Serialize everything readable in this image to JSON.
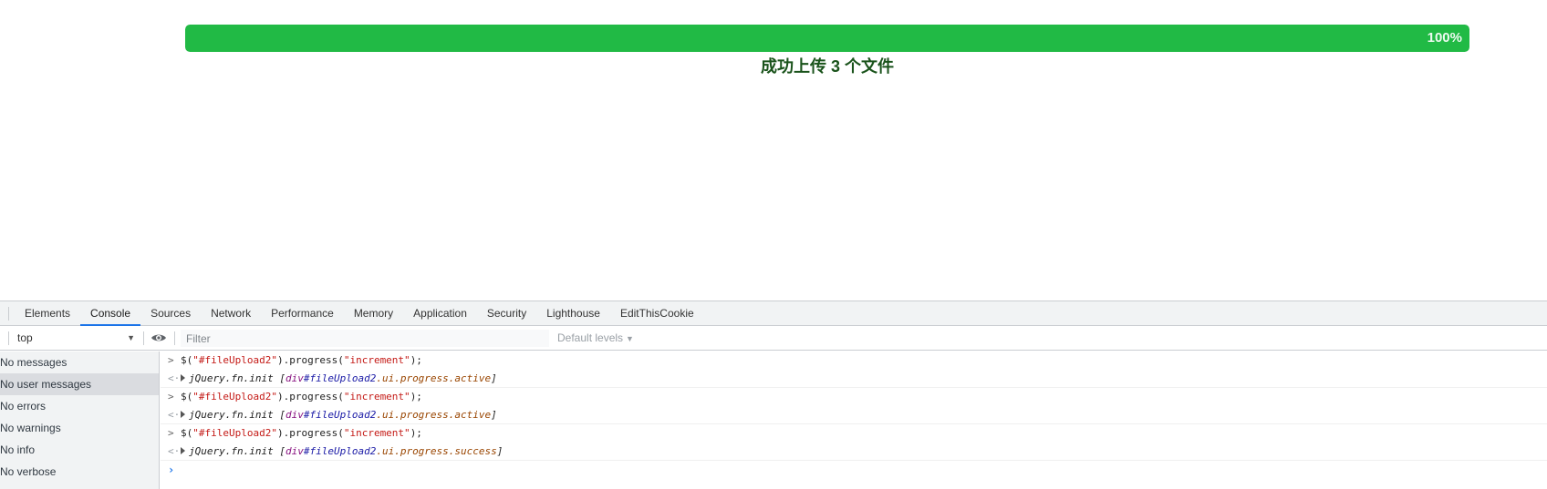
{
  "page": {
    "progress": {
      "percent": 100,
      "percent_label": "100%",
      "label": "成功上传 3 个文件",
      "bar_color": "#21ba45"
    }
  },
  "devtools": {
    "tabs": [
      {
        "label": "Elements"
      },
      {
        "label": "Console",
        "selected": true
      },
      {
        "label": "Sources"
      },
      {
        "label": "Network"
      },
      {
        "label": "Performance"
      },
      {
        "label": "Memory"
      },
      {
        "label": "Application"
      },
      {
        "label": "Security"
      },
      {
        "label": "Lighthouse"
      },
      {
        "label": "EditThisCookie"
      }
    ],
    "toolbar": {
      "context": "top",
      "filter_placeholder": "Filter",
      "levels": "Default levels"
    },
    "sidebar": [
      {
        "label": "No messages"
      },
      {
        "label": "No user messages",
        "selected": true
      },
      {
        "label": "No errors"
      },
      {
        "label": "No warnings"
      },
      {
        "label": "No info"
      },
      {
        "label": "No verbose"
      }
    ],
    "console": [
      {
        "cmd": [
          "$(",
          "\"#fileUpload2\"",
          ").progress(",
          "\"increment\"",
          ");"
        ],
        "result": [
          "jQuery.fn.init ",
          "[",
          "div",
          "#fileUpload2",
          ".ui.progress.active",
          "]"
        ]
      },
      {
        "cmd": [
          "$(",
          "\"#fileUpload2\"",
          ").progress(",
          "\"increment\"",
          ");"
        ],
        "result": [
          "jQuery.fn.init ",
          "[",
          "div",
          "#fileUpload2",
          ".ui.progress.active",
          "]"
        ]
      },
      {
        "cmd": [
          "$(",
          "\"#fileUpload2\"",
          ").progress(",
          "\"increment\"",
          ");"
        ],
        "result": [
          "jQuery.fn.init ",
          "[",
          "div",
          "#fileUpload2",
          ".ui.progress.success",
          "]"
        ]
      }
    ],
    "icons": {
      "context_dropdown": "triangle-down-icon",
      "live_expression": "eye-icon",
      "levels_dropdown": "triangle-down-icon"
    }
  }
}
